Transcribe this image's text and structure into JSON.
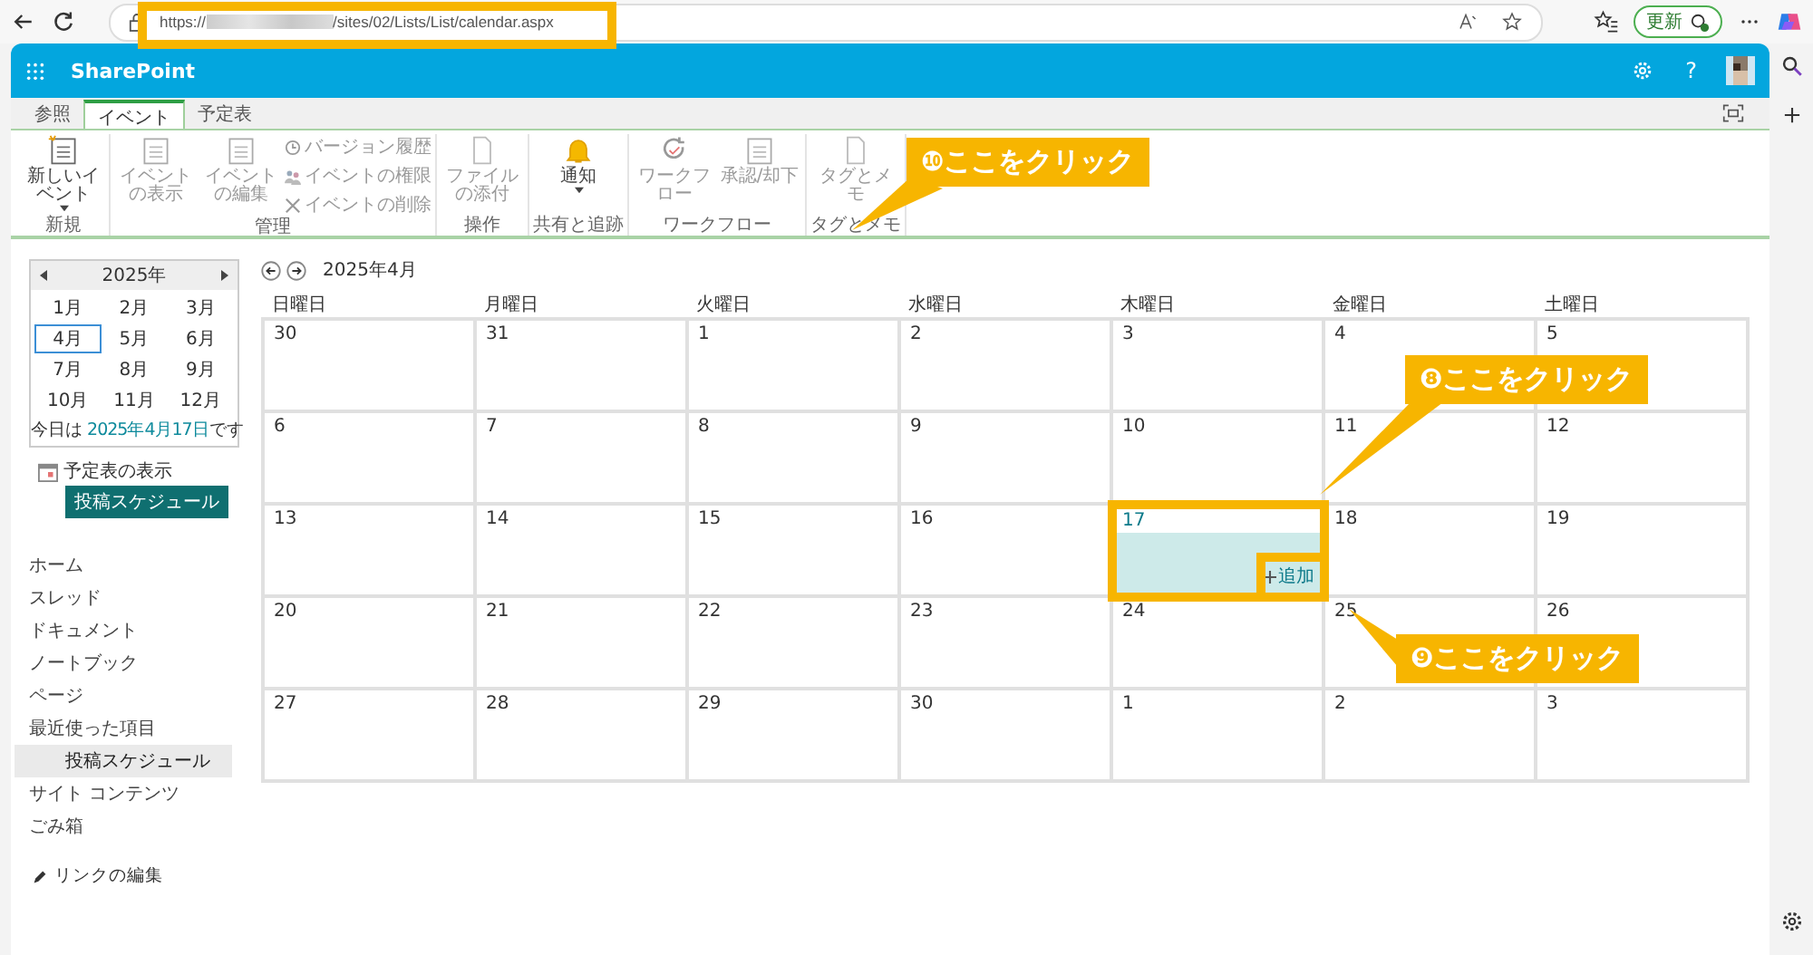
{
  "browser": {
    "url_start": "https://",
    "url_end": "/sites/02/Lists/List/calendar.aspx",
    "update_button": "更新"
  },
  "suite_bar": {
    "title": "SharePoint",
    "help": "?"
  },
  "ribbon": {
    "tabs": [
      {
        "label": "参照",
        "selected": false
      },
      {
        "label": "イベント",
        "selected": true
      },
      {
        "label": "予定表",
        "selected": false
      }
    ],
    "groups": [
      {
        "label": "新規",
        "buttons": [
          {
            "kind": "large",
            "label": "新しいイベント",
            "disabled": false,
            "dropdown": true
          }
        ]
      },
      {
        "label": "管理",
        "buttons": [
          {
            "kind": "large",
            "label": "イベントの表示",
            "disabled": true,
            "dropdown": false
          },
          {
            "kind": "large",
            "label": "イベントの編集",
            "disabled": true,
            "dropdown": false
          },
          {
            "kind": "small",
            "label": "バージョン履歴",
            "disabled": true
          },
          {
            "kind": "small",
            "label": "イベントの権限",
            "disabled": true
          },
          {
            "kind": "small",
            "label": "イベントの削除",
            "disabled": true
          }
        ]
      },
      {
        "label": "操作",
        "buttons": [
          {
            "kind": "large",
            "label": "ファイルの添付",
            "disabled": true,
            "dropdown": false
          }
        ]
      },
      {
        "label": "共有と追跡",
        "buttons": [
          {
            "kind": "large",
            "label": "通知",
            "disabled": false,
            "dropdown": true
          }
        ]
      },
      {
        "label": "ワークフロー",
        "buttons": [
          {
            "kind": "large",
            "label": "ワークフロー",
            "disabled": true,
            "dropdown": false
          },
          {
            "kind": "large",
            "label": "承認/却下",
            "disabled": true,
            "dropdown": false
          }
        ]
      },
      {
        "label": "タグとメモ",
        "buttons": [
          {
            "kind": "large",
            "label": "タグとメモ",
            "disabled": true,
            "dropdown": false
          }
        ]
      }
    ]
  },
  "mini_calendar": {
    "year": "2025年",
    "months": [
      {
        "label": "1月",
        "selected": false
      },
      {
        "label": "2月",
        "selected": false
      },
      {
        "label": "3月",
        "selected": false
      },
      {
        "label": "4月",
        "selected": true
      },
      {
        "label": "5月",
        "selected": false
      },
      {
        "label": "6月",
        "selected": false
      },
      {
        "label": "7月",
        "selected": false
      },
      {
        "label": "8月",
        "selected": false
      },
      {
        "label": "9月",
        "selected": false
      },
      {
        "label": "10月",
        "selected": false
      },
      {
        "label": "11月",
        "selected": false
      },
      {
        "label": "12月",
        "selected": false
      }
    ],
    "today_prefix": "今日は ",
    "today_link": "2025年4月17日",
    "today_suffix": "です"
  },
  "calendars": {
    "label": "予定表の表示",
    "items": [
      {
        "label": "投稿スケジュール",
        "selected": true
      }
    ]
  },
  "nav": [
    {
      "label": "ホーム",
      "selected": false
    },
    {
      "label": "スレッド",
      "selected": false
    },
    {
      "label": "ドキュメント",
      "selected": false
    },
    {
      "label": "ノートブック",
      "selected": false
    },
    {
      "label": "ページ",
      "selected": false
    },
    {
      "label": "最近使った項目",
      "selected": false,
      "children": [
        {
          "label": "投稿スケジュール",
          "selected": true
        }
      ]
    },
    {
      "label": "サイト コンテンツ",
      "selected": false
    },
    {
      "label": "ごみ箱",
      "selected": false
    }
  ],
  "edit_links": "リンクの編集",
  "calendar": {
    "title": "2025年4月",
    "weekdays": [
      "日曜日",
      "月曜日",
      "火曜日",
      "水曜日",
      "木曜日",
      "金曜日",
      "土曜日"
    ],
    "add_label": "追加",
    "weeks": [
      [
        {
          "day": "30",
          "selected": false
        },
        {
          "day": "31",
          "selected": false
        },
        {
          "day": "1",
          "selected": false
        },
        {
          "day": "2",
          "selected": false
        },
        {
          "day": "3",
          "selected": false
        },
        {
          "day": "4",
          "selected": false
        },
        {
          "day": "5",
          "selected": false
        }
      ],
      [
        {
          "day": "6",
          "selected": false
        },
        {
          "day": "7",
          "selected": false
        },
        {
          "day": "8",
          "selected": false
        },
        {
          "day": "9",
          "selected": false
        },
        {
          "day": "10",
          "selected": false
        },
        {
          "day": "11",
          "selected": false
        },
        {
          "day": "12",
          "selected": false
        }
      ],
      [
        {
          "day": "13",
          "selected": false
        },
        {
          "day": "14",
          "selected": false
        },
        {
          "day": "15",
          "selected": false
        },
        {
          "day": "16",
          "selected": false
        },
        {
          "day": "17",
          "selected": true
        },
        {
          "day": "18",
          "selected": false
        },
        {
          "day": "19",
          "selected": false
        }
      ],
      [
        {
          "day": "20",
          "selected": false
        },
        {
          "day": "21",
          "selected": false
        },
        {
          "day": "22",
          "selected": false
        },
        {
          "day": "23",
          "selected": false
        },
        {
          "day": "24",
          "selected": false
        },
        {
          "day": "25",
          "selected": false
        },
        {
          "day": "26",
          "selected": false
        }
      ],
      [
        {
          "day": "27",
          "selected": false
        },
        {
          "day": "28",
          "selected": false
        },
        {
          "day": "29",
          "selected": false
        },
        {
          "day": "30",
          "selected": false
        },
        {
          "day": "1",
          "selected": false
        },
        {
          "day": "2",
          "selected": false
        },
        {
          "day": "3",
          "selected": false
        }
      ]
    ]
  },
  "callouts": [
    "❿ここをクリック",
    "❽ここをクリック",
    "❾ここをクリック"
  ]
}
